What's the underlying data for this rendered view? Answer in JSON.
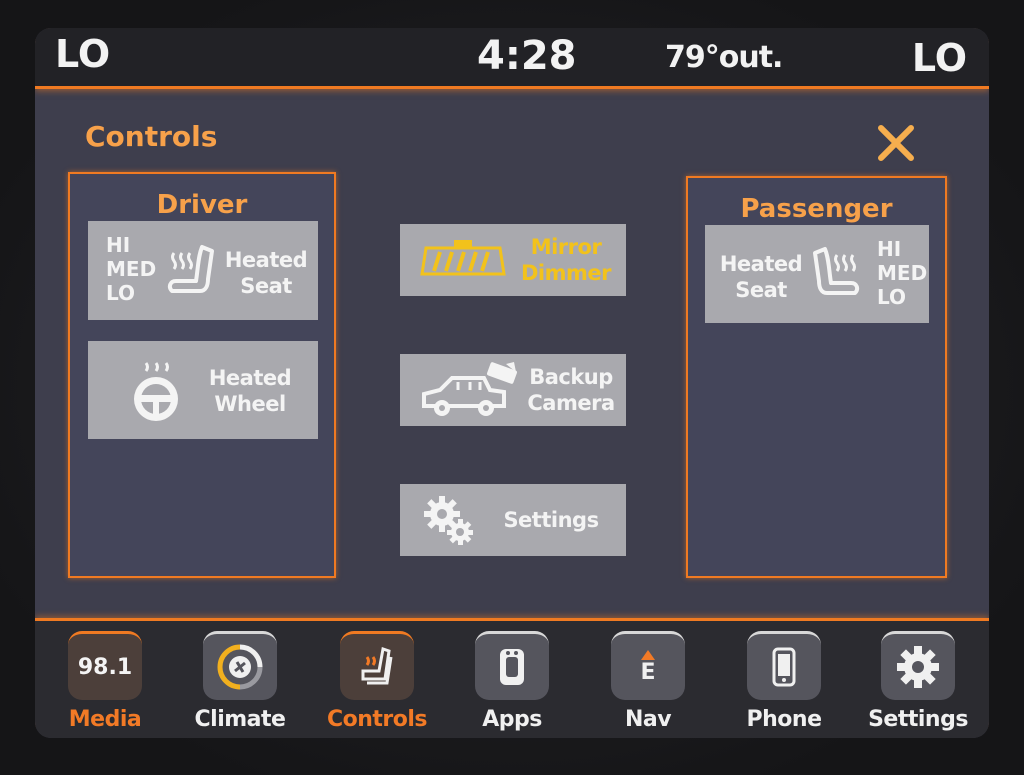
{
  "status": {
    "temp_left": "LO",
    "clock": "4:28",
    "outside_temp": "79°out.",
    "temp_right": "LO"
  },
  "page": {
    "title": "Controls",
    "close_icon": "close-x-icon"
  },
  "driver": {
    "title": "Driver",
    "seat": {
      "levels": [
        "HI",
        "MED",
        "LO"
      ],
      "label_line1": "Heated",
      "label_line2": "Seat",
      "icon": "heated-seat-icon"
    },
    "wheel": {
      "label_line1": "Heated",
      "label_line2": "Wheel",
      "icon": "heated-wheel-icon"
    }
  },
  "center": {
    "mirror": {
      "label_line1": "Mirror",
      "label_line2": "Dimmer",
      "icon": "mirror-icon"
    },
    "camera": {
      "label_line1": "Backup",
      "label_line2": "Camera",
      "icon": "backup-camera-icon"
    },
    "settings": {
      "label": "Settings",
      "icon": "gear-icon"
    }
  },
  "passenger": {
    "title": "Passenger",
    "seat": {
      "levels": [
        "HI",
        "MED",
        "LO"
      ],
      "label_line1": "Heated",
      "label_line2": "Seat",
      "icon": "heated-seat-icon"
    }
  },
  "dock": {
    "items": [
      {
        "label": "Media",
        "badge": "98.1",
        "active": true
      },
      {
        "label": "Climate",
        "icon": "climate-fan-icon"
      },
      {
        "label": "Controls",
        "icon": "controls-seat-icon",
        "active": true
      },
      {
        "label": "Apps",
        "icon": "apps-icon"
      },
      {
        "label": "Nav",
        "icon": "compass-icon",
        "compass": "E"
      },
      {
        "label": "Phone",
        "icon": "phone-icon"
      },
      {
        "label": "Settings",
        "icon": "gear-icon"
      }
    ]
  },
  "colors": {
    "accent": "#f07a22",
    "title_orange": "#f7a14a",
    "mirror_yellow": "#f2c21b"
  }
}
